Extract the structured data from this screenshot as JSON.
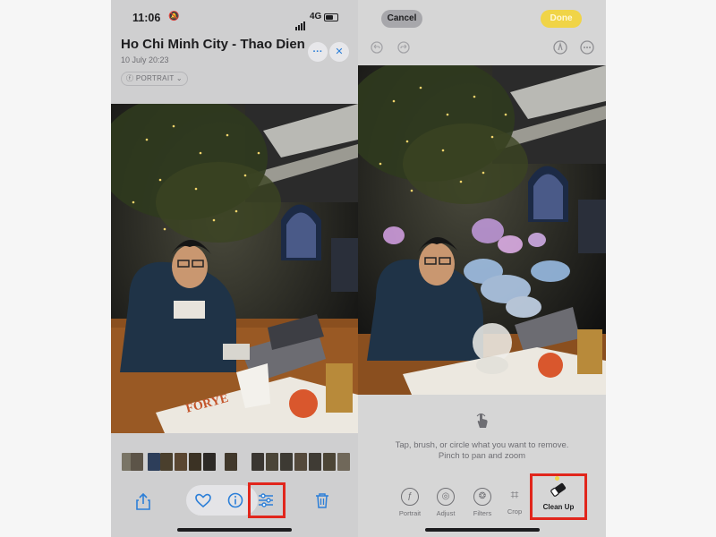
{
  "left": {
    "status": {
      "time": "11:06",
      "network": "4G"
    },
    "header": {
      "title": "Ho Chi Minh City - Thao Dien",
      "date": "10 July  20:23",
      "badge": "PORTRAIT",
      "more_glyph": "···",
      "close_glyph": "✕"
    },
    "toolbar": [
      "share-icon",
      "heart-icon",
      "info-icon",
      "adjust-icon",
      "trash-icon"
    ]
  },
  "right": {
    "cancel_label": "Cancel",
    "done_label": "Done",
    "hint_line1": "Tap, brush, or circle what you want to remove.",
    "hint_line2": "Pinch to pan and zoom",
    "tools": [
      {
        "label": "Portrait",
        "icon": "f-icon"
      },
      {
        "label": "Adjust",
        "icon": "adjust-dial-icon"
      },
      {
        "label": "Filters",
        "icon": "filters-icon"
      },
      {
        "label": "Crop",
        "icon": "crop-icon"
      }
    ],
    "cleanup_label": "Clean Up",
    "accent_color": "#f0d447",
    "highlight_color": "#e1261c"
  }
}
